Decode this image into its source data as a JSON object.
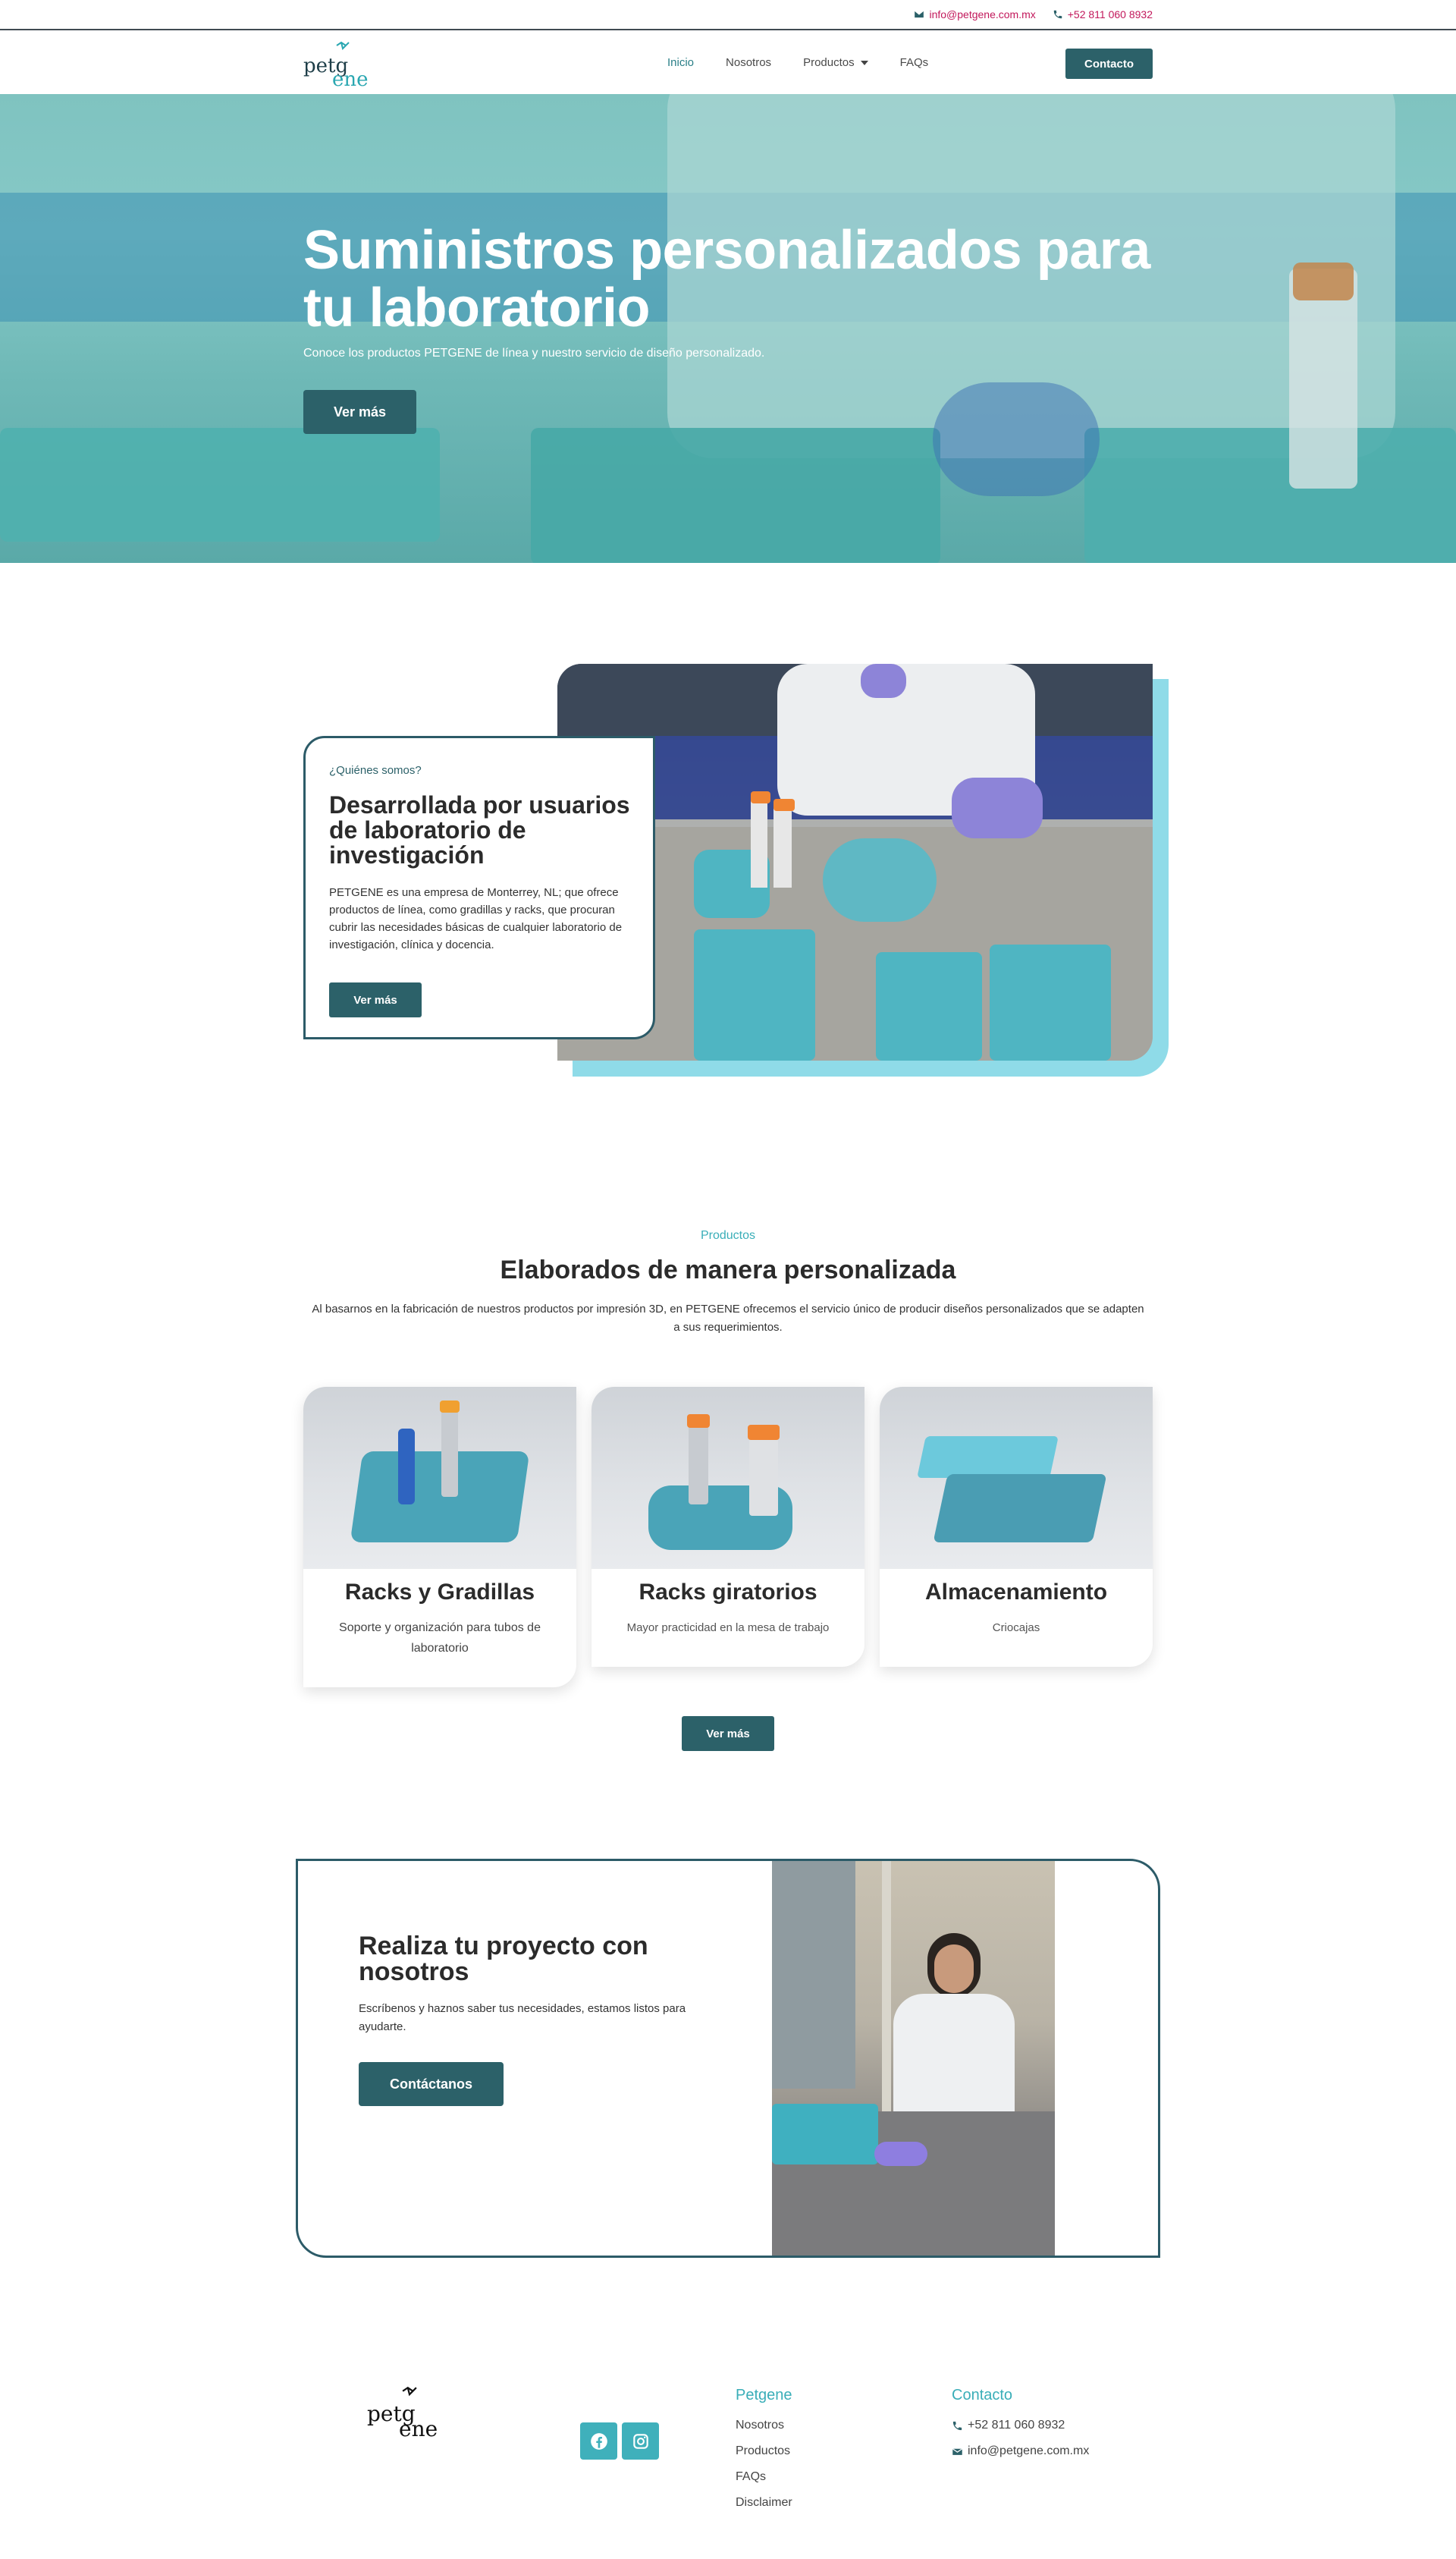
{
  "topbar": {
    "email": "info@petgene.com.mx",
    "phone": "+52 811 060 8932"
  },
  "nav": {
    "logo": {
      "part1": "petg",
      "part2": "ene"
    },
    "items": [
      {
        "label": "Inicio",
        "active": true
      },
      {
        "label": "Nosotros",
        "active": false
      },
      {
        "label": "Productos",
        "active": false,
        "dropdown": true
      },
      {
        "label": "FAQs",
        "active": false
      }
    ],
    "contact_button": "Contacto"
  },
  "hero": {
    "title": "Suministros personalizados para tu laboratorio",
    "subtitle": "Conoce los productos PETGENE de línea y nuestro servicio de diseño personalizado.",
    "button": "Ver más"
  },
  "about": {
    "eyebrow": "¿Quiénes somos?",
    "title": "Desarrollada por usuarios de laboratorio de investigación",
    "text": "PETGENE es una empresa de Monterrey, NL; que ofrece productos de línea, como gradillas y racks, que procuran cubrir las necesidades básicas de cualquier laboratorio de investigación, clínica y docencia.",
    "button": "Ver más"
  },
  "products": {
    "eyebrow": "Productos",
    "title": "Elaborados de manera personalizada",
    "text": "Al basarnos en la fabricación de nuestros productos por impresión 3D, en PETGENE ofrecemos el servicio único de producir diseños personalizados que se adapten a sus requerimientos.",
    "cards": [
      {
        "title": "Racks y Gradillas",
        "subtitle": "Soporte y organización para tubos de laboratorio"
      },
      {
        "title": "Racks giratorios",
        "subtitle": "Mayor practicidad en la mesa de trabajo"
      },
      {
        "title": "Almacenamiento",
        "subtitle": "Criocajas"
      }
    ],
    "button": "Ver más"
  },
  "cta": {
    "title": "Realiza tu proyecto con nosotros",
    "text": "Escríbenos y haznos saber tus necesidades, estamos listos para ayudarte.",
    "button": "Contáctanos"
  },
  "footer": {
    "logo": {
      "part1": "petg",
      "part2": "ene"
    },
    "petgene_title": "Petgene",
    "links": [
      "Nosotros",
      "Productos",
      "FAQs",
      "Disclaimer"
    ],
    "contact_title": "Contacto",
    "phone": "+52 811 060 8932",
    "email": "info@petgene.com.mx",
    "social": [
      "facebook-icon",
      "instagram-icon"
    ]
  },
  "colors": {
    "primary": "#2c6169",
    "accent": "#3aaeb8",
    "light_accent": "#8fdbe8",
    "topbar_link": "#c2185b"
  }
}
